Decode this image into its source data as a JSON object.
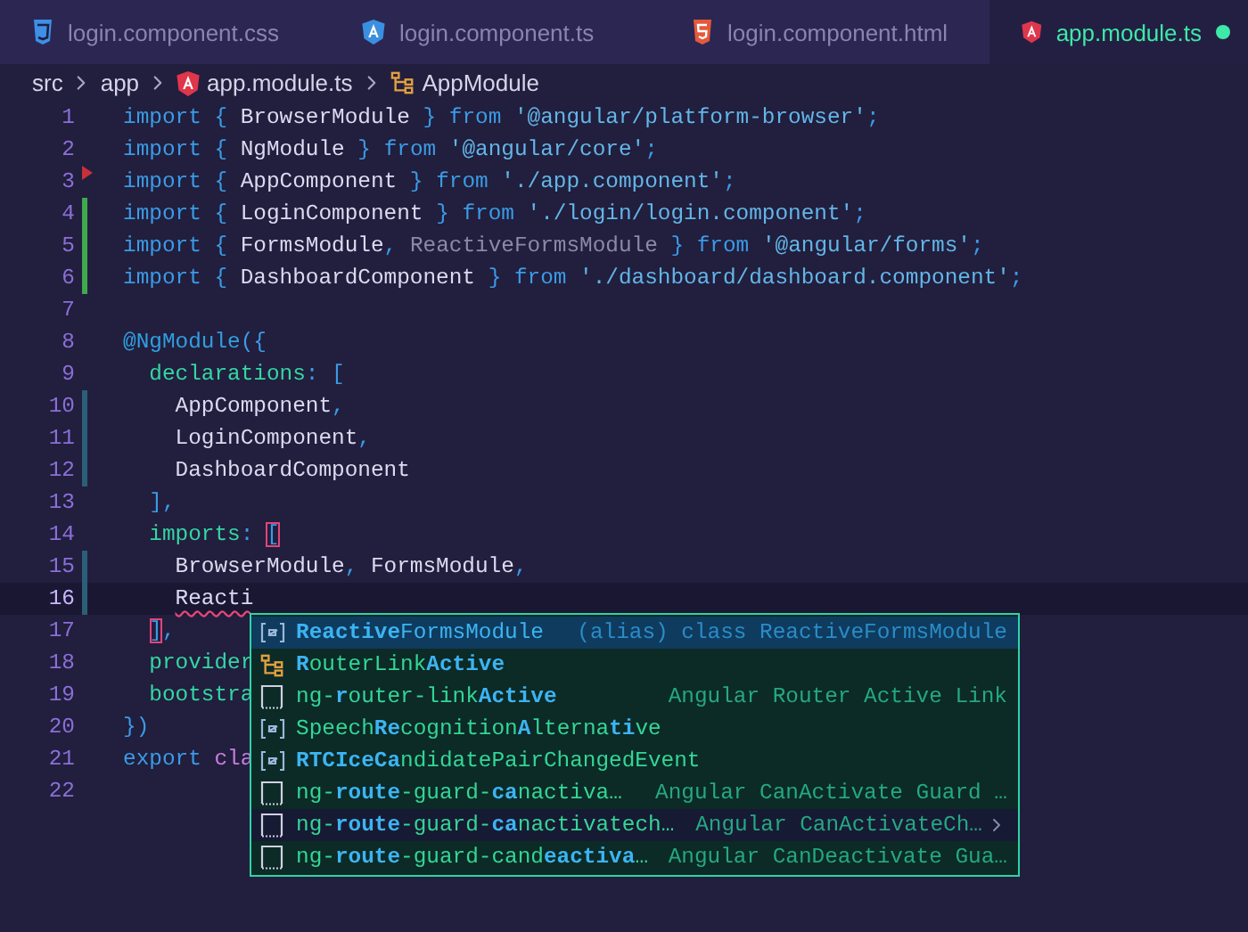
{
  "tabs": [
    {
      "label": "login.component.css",
      "kind": "css",
      "selected": false,
      "modified": false
    },
    {
      "label": "login.component.ts",
      "kind": "typescript",
      "selected": false,
      "modified": false
    },
    {
      "label": "login.component.html",
      "kind": "html",
      "selected": false,
      "modified": false
    },
    {
      "label": "app.module.ts",
      "kind": "module",
      "selected": true,
      "modified": true
    }
  ],
  "breadcrumb": [
    {
      "label": "src",
      "kind": "folder"
    },
    {
      "label": "app",
      "kind": "folder"
    },
    {
      "label": "app.module.ts",
      "kind": "file"
    },
    {
      "label": "AppModule",
      "kind": "class"
    }
  ],
  "lines": [
    {
      "number": "1",
      "active": false,
      "tokens": [
        {
          "kind": "keyword",
          "t": "import"
        },
        {
          "kind": "punct",
          "t": " { "
        },
        {
          "kind": "name",
          "t": "BrowserModule"
        },
        {
          "kind": "punct",
          "t": " } "
        },
        {
          "kind": "keyword",
          "t": "from"
        },
        {
          "kind": "string",
          "t": " '@angular/platform-browser'"
        },
        {
          "kind": "punct",
          "t": ";"
        }
      ]
    },
    {
      "number": "2",
      "active": false,
      "tokens": [
        {
          "kind": "keyword",
          "t": "import"
        },
        {
          "kind": "punct",
          "t": " { "
        },
        {
          "kind": "name",
          "t": "NgModule"
        },
        {
          "kind": "punct",
          "t": " } "
        },
        {
          "kind": "keyword",
          "t": "from"
        },
        {
          "kind": "string",
          "t": " '@angular/core'"
        },
        {
          "kind": "punct",
          "t": ";"
        }
      ]
    },
    {
      "number": "3",
      "marker": true,
      "active": false,
      "tokens": [
        {
          "kind": "keyword",
          "t": "import"
        },
        {
          "kind": "punct",
          "t": " { "
        },
        {
          "kind": "name",
          "t": "AppComponent"
        },
        {
          "kind": "punct",
          "t": " } "
        },
        {
          "kind": "keyword",
          "t": "from"
        },
        {
          "kind": "string",
          "t": " './app.component'"
        },
        {
          "kind": "punct",
          "t": ";"
        }
      ]
    },
    {
      "number": "4",
      "kind": "added",
      "active": false,
      "tokens": [
        {
          "kind": "keyword",
          "t": "import"
        },
        {
          "kind": "punct",
          "t": " { "
        },
        {
          "kind": "name",
          "t": "LoginComponent"
        },
        {
          "kind": "punct",
          "t": " } "
        },
        {
          "kind": "keyword",
          "t": "from"
        },
        {
          "kind": "string",
          "t": " './login/login.component'"
        },
        {
          "kind": "punct",
          "t": ";"
        }
      ]
    },
    {
      "number": "5",
      "kind": "added",
      "active": false,
      "tokens": [
        {
          "kind": "keyword",
          "t": "import"
        },
        {
          "kind": "punct",
          "t": " { "
        },
        {
          "kind": "name",
          "t": "FormsModule"
        },
        {
          "kind": "punct",
          "t": ", "
        },
        {
          "kind": "unused",
          "t": "ReactiveFormsModule"
        },
        {
          "kind": "punct",
          "t": " } "
        },
        {
          "kind": "keyword",
          "t": "from"
        },
        {
          "kind": "string",
          "t": " '@angular/forms'"
        },
        {
          "kind": "punct",
          "t": ";"
        }
      ]
    },
    {
      "number": "6",
      "kind": "added",
      "active": false,
      "tokens": [
        {
          "kind": "keyword",
          "t": "import"
        },
        {
          "kind": "punct",
          "t": " { "
        },
        {
          "kind": "name",
          "t": "DashboardComponent"
        },
        {
          "kind": "punct",
          "t": " } "
        },
        {
          "kind": "keyword",
          "t": "from"
        },
        {
          "kind": "string",
          "t": " './dashboard/dashboard.component'"
        },
        {
          "kind": "punct",
          "t": ";"
        }
      ]
    },
    {
      "number": "7",
      "active": false
    },
    {
      "number": "8",
      "active": false,
      "tokens": [
        {
          "kind": "decorator",
          "t": "@NgModule"
        },
        {
          "kind": "punct",
          "t": "({"
        }
      ]
    },
    {
      "number": "9",
      "active": false,
      "tokens": [
        {
          "kind": "property",
          "t": "  declarations"
        },
        {
          "kind": "punct",
          "t": ": ["
        }
      ]
    },
    {
      "number": "10",
      "kind": "modified",
      "active": false,
      "tokens": [
        {
          "kind": "name",
          "t": "    AppComponent"
        },
        {
          "kind": "punct",
          "t": ","
        }
      ]
    },
    {
      "number": "11",
      "kind": "modified",
      "active": false,
      "tokens": [
        {
          "kind": "name",
          "t": "    LoginComponent"
        },
        {
          "kind": "punct",
          "t": ","
        }
      ]
    },
    {
      "number": "12",
      "kind": "modified",
      "active": false,
      "tokens": [
        {
          "kind": "name",
          "t": "    DashboardComponent"
        }
      ]
    },
    {
      "number": "13",
      "active": false,
      "tokens": [
        {
          "kind": "punct",
          "t": "  ],"
        }
      ]
    },
    {
      "number": "14",
      "active": false,
      "tokens": [
        {
          "kind": "property",
          "t": "  imports"
        },
        {
          "kind": "punct",
          "t": ": "
        },
        {
          "kind": "bracket",
          "t": "["
        }
      ]
    },
    {
      "number": "15",
      "kind": "modified",
      "active": false,
      "tokens": [
        {
          "kind": "name",
          "t": "    BrowserModule"
        },
        {
          "kind": "punct",
          "t": ", "
        },
        {
          "kind": "name",
          "t": "FormsModule"
        },
        {
          "kind": "punct",
          "t": ","
        }
      ]
    },
    {
      "number": "16",
      "kind": "modified",
      "active": true,
      "tokens": [
        {
          "kind": "error",
          "t": "    Reacti"
        }
      ]
    },
    {
      "number": "17",
      "active": false,
      "tokens": [
        {
          "kind": "bracket",
          "t": "  ]"
        },
        {
          "kind": "punct",
          "t": ","
        }
      ]
    },
    {
      "number": "18",
      "active": false,
      "tokens": [
        {
          "kind": "property",
          "t": "  provider"
        }
      ]
    },
    {
      "number": "19",
      "active": false,
      "tokens": [
        {
          "kind": "property",
          "t": "  bootstra"
        }
      ]
    },
    {
      "number": "20",
      "active": false,
      "tokens": [
        {
          "kind": "punct",
          "t": "})"
        }
      ]
    },
    {
      "number": "21",
      "active": false,
      "tokens": [
        {
          "kind": "keyword",
          "t": "export"
        },
        {
          "kind": "storage",
          "t": " cla"
        }
      ]
    },
    {
      "number": "22",
      "active": false
    }
  ],
  "suggestions": [
    {
      "kind": "variable",
      "selected": true,
      "hovered": false,
      "label": [
        {
          "t": "Reactive",
          "match": true
        },
        {
          "t": "FormsModule",
          "match": false
        }
      ],
      "detail": "(alias) class ReactiveFormsModule"
    },
    {
      "kind": "class",
      "selected": false,
      "hovered": false,
      "label": [
        {
          "t": "R",
          "match": true
        },
        {
          "t": "outerLink",
          "match": false
        },
        {
          "t": "Active",
          "match": true
        }
      ]
    },
    {
      "kind": "snippet",
      "selected": false,
      "hovered": false,
      "label": [
        {
          "t": "ng-",
          "match": false
        },
        {
          "t": "r",
          "match": true
        },
        {
          "t": "outer-link",
          "match": false
        },
        {
          "t": "Active",
          "match": true
        }
      ],
      "detail": "Angular Router Active Link"
    },
    {
      "kind": "variable",
      "selected": false,
      "hovered": false,
      "label": [
        {
          "t": "Speech",
          "match": false
        },
        {
          "t": "Re",
          "match": true
        },
        {
          "t": "cognition",
          "match": false
        },
        {
          "t": "A",
          "match": true
        },
        {
          "t": "lterna",
          "match": false
        },
        {
          "t": "ti",
          "match": true
        },
        {
          "t": "ve",
          "match": false
        }
      ]
    },
    {
      "kind": "variable",
      "selected": false,
      "hovered": false,
      "label": [
        {
          "t": "RTCIceCa",
          "match": true
        },
        {
          "t": "ndidatePairChangedEvent",
          "match": false
        }
      ]
    },
    {
      "kind": "snippet",
      "selected": false,
      "hovered": false,
      "label": [
        {
          "t": "ng-",
          "match": false
        },
        {
          "t": "route",
          "match": true
        },
        {
          "t": "-guard-",
          "match": false
        },
        {
          "t": "ca",
          "match": true
        },
        {
          "t": "nactiva…",
          "match": false
        }
      ],
      "detail": "Angular CanActivate Guard …"
    },
    {
      "kind": "snippet",
      "selected": false,
      "hovered": true,
      "label": [
        {
          "t": "ng-",
          "match": false
        },
        {
          "t": "route",
          "match": true
        },
        {
          "t": "-guard-",
          "match": false
        },
        {
          "t": "ca",
          "match": true
        },
        {
          "t": "nactivatech…",
          "match": false
        }
      ],
      "detail": "Angular CanActivateCh…"
    },
    {
      "kind": "snippet",
      "selected": false,
      "hovered": false,
      "label": [
        {
          "t": "ng-",
          "match": false
        },
        {
          "t": "route",
          "match": true
        },
        {
          "t": "-guard-cand",
          "match": false
        },
        {
          "t": "eactiva",
          "match": true
        },
        {
          "t": "…",
          "match": false
        }
      ],
      "detail": "Angular CanDeactivate Gua…"
    }
  ]
}
